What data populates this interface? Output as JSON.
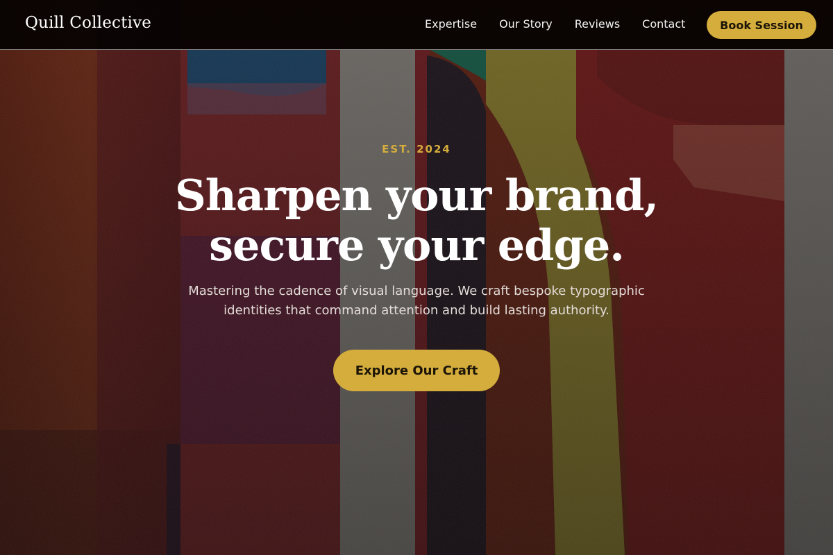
{
  "header": {
    "brand": "Quill Collective",
    "nav": [
      "Expertise",
      "Our Story",
      "Reviews",
      "Contact"
    ],
    "book_label": "Book Session"
  },
  "hero": {
    "eyebrow": "EST. 2024",
    "headline_line1": "Sharpen your brand,",
    "headline_line2": "secure your edge.",
    "subtext": "Mastering the cadence of visual language. We craft bespoke typographic identities that command attention and build lasting authority.",
    "cta_label": "Explore Our Craft"
  },
  "colors": {
    "accent": "#d4ad3c",
    "navbar": "#000000",
    "headline": "#ffffff"
  }
}
